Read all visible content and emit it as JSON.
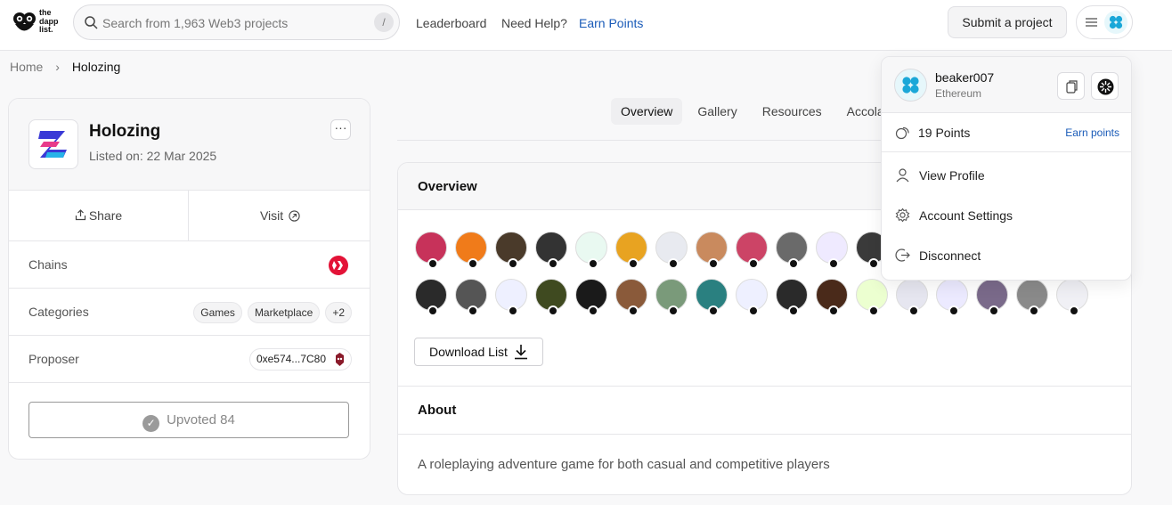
{
  "topbar": {
    "logo_text": [
      "the",
      "dapp",
      "list."
    ],
    "search_placeholder": "Search from 1,963 Web3 projects",
    "search_shortcut": "/",
    "nav": [
      "Leaderboard",
      "Need Help?",
      "Earn Points"
    ],
    "submit_label": "Submit a project"
  },
  "breadcrumb": {
    "home": "Home",
    "current": "Holozing"
  },
  "project": {
    "name": "Holozing",
    "listed": "Listed on: 22 Mar 2025",
    "share_label": "Share",
    "visit_label": "Visit",
    "chains_label": "Chains",
    "categories_label": "Categories",
    "categories": [
      "Games",
      "Marketplace",
      "+2"
    ],
    "proposer_label": "Proposer",
    "proposer_address": "0xe574...7C80",
    "upvote_label": "Upvoted 84"
  },
  "tabs": [
    "Overview",
    "Gallery",
    "Resources",
    "Accola"
  ],
  "overview": {
    "title": "Overview",
    "download_label": "Download List",
    "about_title": "About",
    "about_text": "A roleplaying adventure game for both casual and competitive players"
  },
  "upvoter_avatars": {
    "row1_colors": [
      "#c7325a",
      "#f07b1a",
      "#4a3a2a",
      "#333333",
      "#e9f9f1",
      "#e8a321",
      "#e8eaf0",
      "#c98a5e",
      "#cc4466",
      "#6a6a6a",
      "#efeaff",
      "#3a3a3a"
    ],
    "row2_colors": [
      "#2a2a2a",
      "#555555",
      "#eef0ff",
      "#3f4a20",
      "#1a1a1a",
      "#8a5a3a",
      "#7a9a7a",
      "#2a8080",
      "#eef0ff",
      "#2a2a2a",
      "#4a2a1a",
      "#ecffd0",
      "#e6e6f0",
      "#eceaff",
      "#7a6a8a",
      "#8a8a8a",
      "#f0f0f5"
    ]
  },
  "account": {
    "username": "beaker007",
    "network": "Ethereum",
    "points": "19 Points",
    "earn_points": "Earn points",
    "menu": [
      "View Profile",
      "Account Settings",
      "Disconnect"
    ]
  },
  "colors": {
    "accent": "#1a5bb8",
    "hive_red": "#e31337",
    "avatar_blue": "#1aa7d8"
  }
}
